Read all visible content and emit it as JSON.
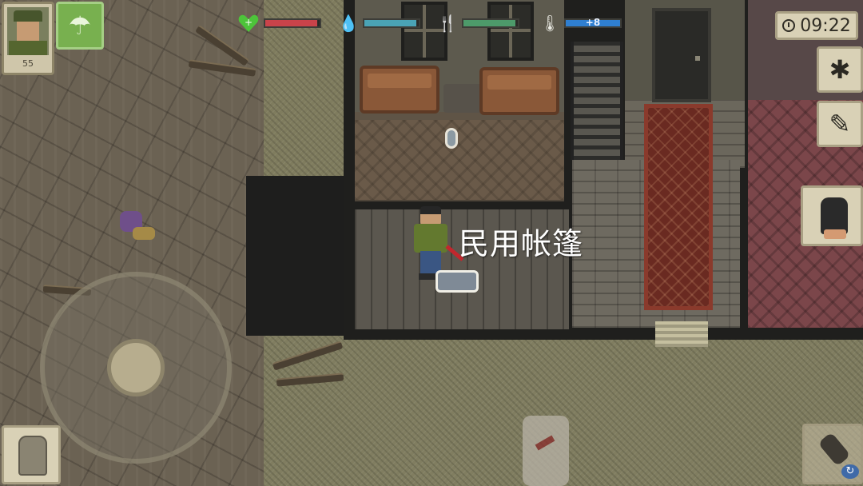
{
  "hud": {
    "portrait": {
      "level": "55"
    },
    "airdrop_icon": "parachute-icon",
    "stats": {
      "health": {
        "icon": "heart-icon",
        "label": "+",
        "value_fraction": 0.95,
        "color": "#c9434a"
      },
      "thirst": {
        "icon": "water-drop-icon",
        "value_fraction": 0.95,
        "color": "#4aa3b5"
      },
      "hunger": {
        "icon": "fork-knife-icon",
        "value_fraction": 0.95,
        "color": "#4d9a6a"
      },
      "temperature": {
        "icon": "thermometer-icon",
        "label": "+8",
        "value_fraction": 1.0,
        "color": "#2f7fd1"
      }
    },
    "clock": {
      "time": "09:22"
    },
    "side_buttons": {
      "settings_icon": "gear-icon",
      "notes_icon": "notebook-icon",
      "interact_icon": "grab-hand-icon"
    },
    "bottom": {
      "backpack_icon": "backpack-icon",
      "weapon_icon": "fist-icon",
      "swap_label": "↻"
    }
  },
  "world": {
    "item_label": "民用帐篷"
  }
}
